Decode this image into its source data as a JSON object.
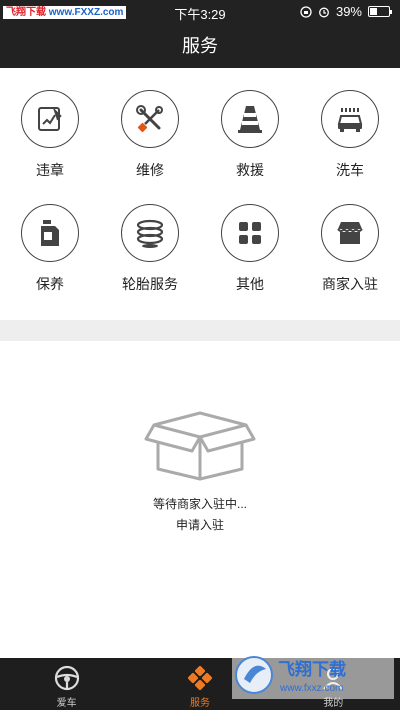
{
  "status_bar": {
    "watermark_left": "飞翔下载",
    "watermark_right": "www.FXXZ.com",
    "time": "下午3:29",
    "battery": "39%",
    "battery_level": 0.39
  },
  "header": {
    "title": "服务"
  },
  "services": [
    {
      "label": "违章",
      "icon": "violation-icon"
    },
    {
      "label": "维修",
      "icon": "repair-tools-icon"
    },
    {
      "label": "救援",
      "icon": "traffic-cone-icon"
    },
    {
      "label": "洗车",
      "icon": "car-wash-icon"
    },
    {
      "label": "保养",
      "icon": "oil-can-icon"
    },
    {
      "label": "轮胎服务",
      "icon": "tires-icon"
    },
    {
      "label": "其他",
      "icon": "grid-icon"
    },
    {
      "label": "商家入驻",
      "icon": "shop-icon"
    }
  ],
  "empty_state": {
    "message": "等待商家入驻中...",
    "action": "申请入驻"
  },
  "tabbar": {
    "active_color": "#f07a24",
    "tabs": [
      {
        "label": "爱车",
        "icon": "steering-wheel-icon"
      },
      {
        "label": "服务",
        "icon": "service-icon"
      },
      {
        "label": "我的",
        "icon": "profile-icon"
      }
    ]
  },
  "watermark": {
    "brand": "飞翔下载",
    "url": "www.fxxz.com"
  }
}
